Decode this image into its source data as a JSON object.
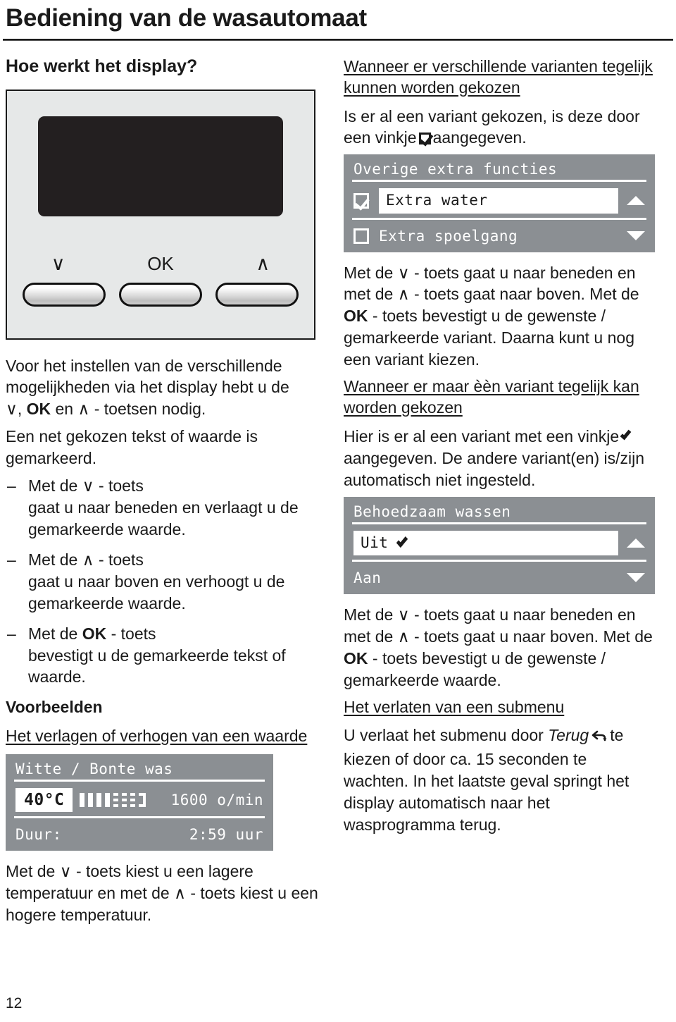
{
  "document": {
    "title": "Bediening van de wasautomaat",
    "page_number": "12"
  },
  "left_column": {
    "section_heading": "Hoe werkt het display?",
    "panel": {
      "label_down": "∨",
      "label_ok": "OK",
      "label_up": "∧"
    },
    "intro_paragraph_1": "Voor het instellen van de verschillende mogelijkheden via het display hebt u de",
    "intro_keys": ", OK en",
    "intro_paragraph_1_end": "- toetsen nodig.",
    "intro_paragraph_2": "Een net gekozen tekst of waarde is gemarkeerd.",
    "bullets": [
      {
        "dash": "–",
        "lead": "Met de",
        "key": "∨",
        "lead_end": "- toets",
        "body": "gaat u naar beneden en verlaagt u de gemarkeerde waarde."
      },
      {
        "dash": "–",
        "lead": "Met de",
        "key": "∧",
        "lead_end": "- toets",
        "body": "gaat u naar boven en verhoogt u de gemarkeerde waarde."
      },
      {
        "dash": "–",
        "lead": "Met de",
        "key": "OK",
        "lead_end": "- toets",
        "body": "bevestigt u de gemarkeerde tekst of waarde."
      }
    ],
    "examples_heading": "Voorbeelden",
    "example_subheading": "Het verlagen of verhogen van een waarde",
    "lcd_witte_bonte": {
      "title": "Witte / Bonte was",
      "temperature": "40°C",
      "spin_speed": "1600 o/min",
      "duration_label": "Duur:",
      "duration_value": "2:59 uur",
      "bar_segments": [
        "full",
        "full",
        "full",
        "full",
        "dot",
        "dot",
        "dot",
        "j"
      ]
    },
    "closing_paragraph_lead": "Met de",
    "closing_key_down": "∨",
    "closing_paragraph_mid": "- toets kiest u een lagere temperatuur en met de",
    "closing_key_up": "∧",
    "closing_paragraph_end": "- toets kiest u een hogere temperatuur."
  },
  "right_column": {
    "heading_1": "Wanneer er verschillende varianten tegelijk kunnen worden gekozen",
    "paragraph_1_pre": "Is er al een variant gekozen, is deze door een vinkje",
    "paragraph_1_post": "aangegeven.",
    "lcd_overige": {
      "title": "Overige extra functies",
      "items": [
        {
          "label": "Extra water",
          "checked": true,
          "highlighted": true,
          "arrow": "up"
        },
        {
          "label": "Extra spoelgang",
          "checked": false,
          "highlighted": false,
          "arrow": "down"
        }
      ]
    },
    "paragraph_2_a": "Met de",
    "paragraph_2_key_down": "∨",
    "paragraph_2_b": "- toets gaat u naar beneden en met de",
    "paragraph_2_key_up": "∧",
    "paragraph_2_c": "- toets gaat naar boven.",
    "paragraph_2_d": "Met de",
    "paragraph_2_key_ok": "OK",
    "paragraph_2_e": "- toets bevestigt u de gewenste / gemarkeerde variant.",
    "paragraph_2_f": "Daarna kunt u nog een variant kiezen.",
    "heading_2": "Wanneer er maar èèn variant tegelijk kan worden gekozen",
    "paragraph_3_pre": "Hier is er al een variant met een vinkje",
    "paragraph_3_post": "aangegeven.",
    "paragraph_3_b": "De andere variant(en) is/zijn automatisch niet ingesteld.",
    "lcd_behoedzaam": {
      "title": "Behoedzaam wassen",
      "items": [
        {
          "label": "Uit",
          "check": true,
          "highlighted": true,
          "arrow": "up"
        },
        {
          "label": "Aan",
          "check": false,
          "highlighted": false,
          "arrow": "down"
        }
      ]
    },
    "paragraph_4_a": "Met de",
    "paragraph_4_key_down": "∨",
    "paragraph_4_b": "- toets gaat u naar beneden en met de",
    "paragraph_4_key_up": "∧",
    "paragraph_4_c": "- toets gaat u naar boven.",
    "paragraph_4_d": "Met de",
    "paragraph_4_key_ok": "OK",
    "paragraph_4_e": "- toets bevestigt u de gewenste / gemarkeerde waarde.",
    "heading_3": "Het verlaten van een submenu",
    "paragraph_5_a": "U verlaat het submenu door",
    "paragraph_5_italic": "Terug",
    "paragraph_5_b": "te kiezen of door ca. 15 seconden te wachten.",
    "paragraph_5_c": "In het laatste geval springt het display automatisch naar het wasprogramma terug."
  },
  "colors": {
    "lcd_background": "#8b8f93",
    "panel_background": "#e6e8e8",
    "screen_black": "#231f20",
    "text": "#1a1a1a"
  }
}
